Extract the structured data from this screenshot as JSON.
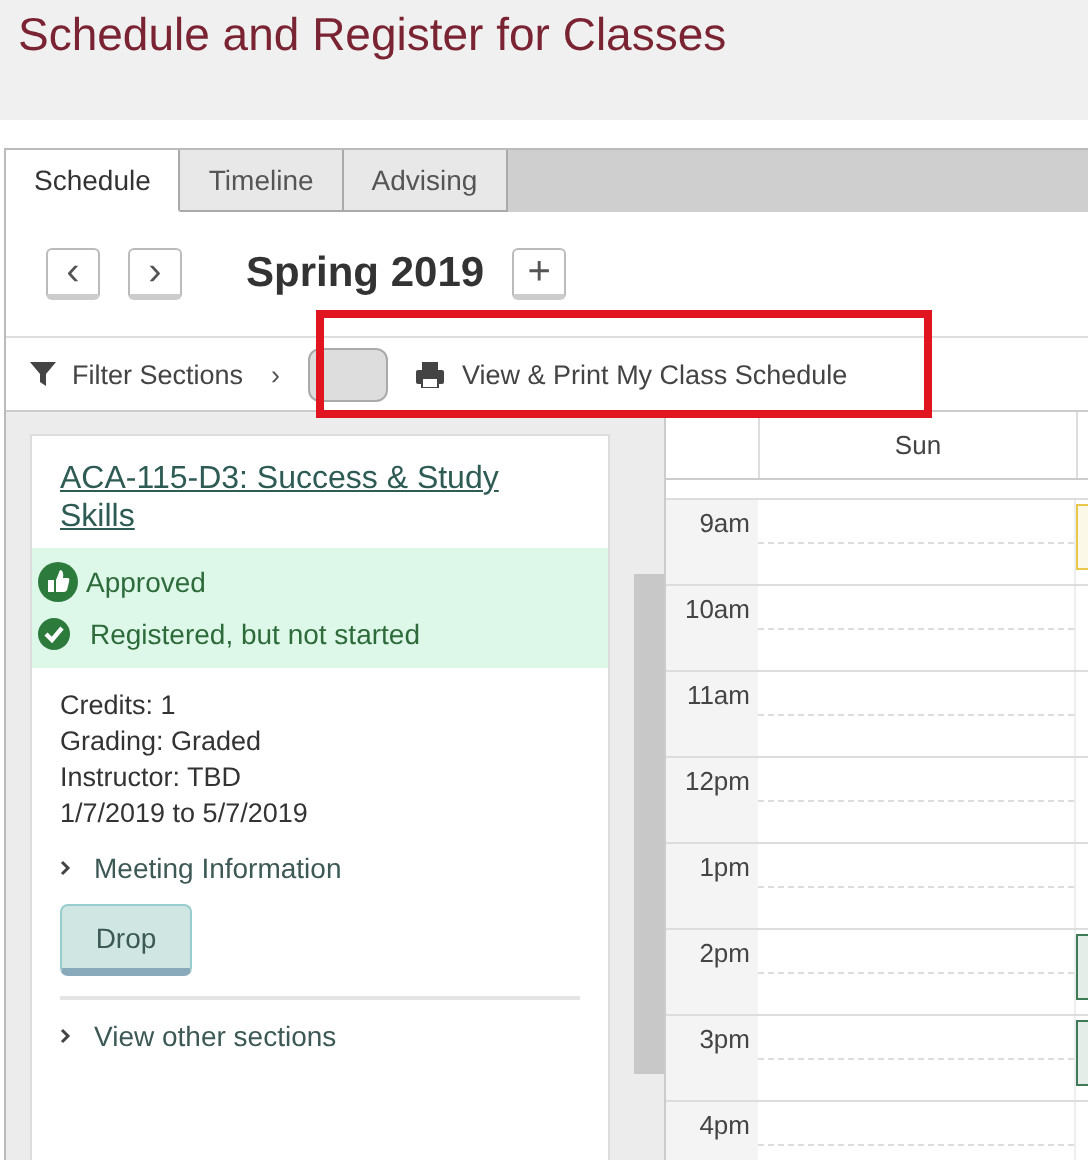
{
  "page_title": "Schedule and Register for Classes",
  "tabs": [
    {
      "label": "Schedule",
      "selected": true
    },
    {
      "label": "Timeline",
      "selected": false
    },
    {
      "label": "Advising",
      "selected": false
    }
  ],
  "term": {
    "prev": "‹",
    "next": "›",
    "name": "Spring 2019",
    "add": "+"
  },
  "toolbar": {
    "filter": "Filter Sections",
    "filter_caret": "›",
    "print": "View & Print My Class Schedule",
    "toggle_on": false,
    "highlighted": true
  },
  "course": {
    "title": "ACA-115-D3: Success & Study Skills",
    "statuses": [
      {
        "kind": "approved",
        "text": "Approved"
      },
      {
        "kind": "registered",
        "text": "Registered, but not started"
      }
    ],
    "details": [
      "Credits: 1",
      "Grading: Graded",
      "Instructor: TBD",
      "1/7/2019 to 5/7/2019"
    ],
    "meeting": "Meeting Information",
    "drop": "Drop",
    "other": "View other sections"
  },
  "calendar": {
    "day": "Sun",
    "hours": [
      {
        "label": "9am",
        "event": {
          "color": "#e8c84a"
        }
      },
      {
        "label": "10am"
      },
      {
        "label": "11am"
      },
      {
        "label": "12pm"
      },
      {
        "label": "1pm"
      },
      {
        "label": "2pm",
        "event": {
          "color": "#3d7a55"
        }
      },
      {
        "label": "3pm",
        "event": {
          "color": "#3d7a55"
        }
      },
      {
        "label": "4pm"
      }
    ]
  }
}
